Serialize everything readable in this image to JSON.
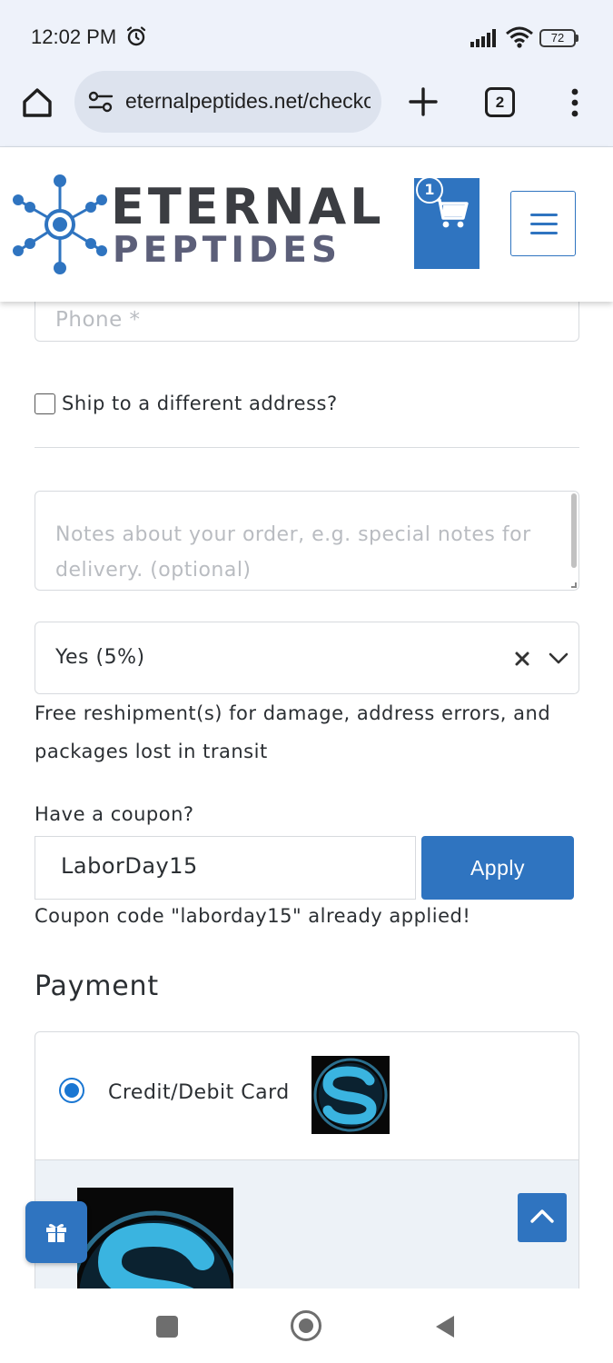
{
  "status_bar": {
    "time": "12:02 PM",
    "battery": "72"
  },
  "browser": {
    "url": "eternalpeptides.net/checkout",
    "tab_count": "2"
  },
  "site_header": {
    "logo_line1": "ETERNAL",
    "logo_line2": "PEPTIDES",
    "cart_count": "1"
  },
  "checkout": {
    "phone_placeholder": "Phone *",
    "ship_different_label": "Ship to a different address?",
    "notes_placeholder": "Notes about your order, e.g. special notes for delivery. (optional)",
    "protection_selected": "Yes (5%)",
    "protection_help": "Free reshipment(s) for damage, address errors, and packages lost in transit",
    "coupon_heading": "Have a coupon?",
    "coupon_value": "LaborDay15",
    "apply_label": "Apply",
    "coupon_notice": "Coupon code \"laborday15\" already applied!"
  },
  "payment": {
    "title": "Payment",
    "method_label": "Credit/Debit Card",
    "method_selected": true
  },
  "colors": {
    "brand_blue": "#2f74c0",
    "logo_dark": "#3b3d42",
    "logo_purple_gray": "#5c5f79",
    "card_logo_cyan": "#3ab4e0"
  },
  "icons": {
    "alarm": "alarm-icon",
    "home": "home-icon",
    "new_tab": "plus-icon",
    "overflow": "overflow-menu-icon",
    "cart": "cart-icon",
    "menu": "hamburger-icon",
    "gift": "gift-icon",
    "scroll_top": "chevron-up-icon"
  }
}
